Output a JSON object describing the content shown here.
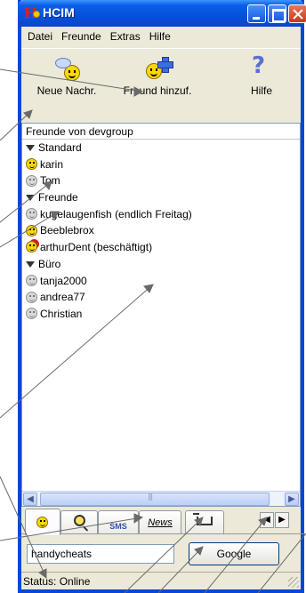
{
  "window": {
    "title": "HCIM",
    "logo_letter": "H"
  },
  "menu": [
    "Datei",
    "Freunde",
    "Extras",
    "Hilfe"
  ],
  "toolbar": {
    "news": "Neue Nachr.",
    "add_friend": "Freund hinzuf.",
    "help": "Hilfe"
  },
  "list": {
    "header": "Freunde von devgroup",
    "rows": [
      {
        "type": "group",
        "text": "Standard"
      },
      {
        "type": "online",
        "text": "karin"
      },
      {
        "type": "offline",
        "text": "Tom"
      },
      {
        "type": "group",
        "text": "Freunde"
      },
      {
        "type": "offline",
        "text": "kugelaugenfish (endlich Freitag)"
      },
      {
        "type": "online",
        "text": "Beeblebrox"
      },
      {
        "type": "busy",
        "text": "arthurDent (beschäftigt)"
      },
      {
        "type": "group",
        "text": "Büro"
      },
      {
        "type": "offline",
        "text": "tanja2000"
      },
      {
        "type": "offline",
        "text": "andrea77"
      },
      {
        "type": "offline",
        "text": "Christian"
      }
    ]
  },
  "tabs": {
    "sms": "SMS",
    "news": "News"
  },
  "search": {
    "value": "handycheats",
    "button": "Google"
  },
  "status": "Status: Online",
  "colors": {
    "titlebar": "#0550dd",
    "frame": "#0a46d8",
    "online": "#ffd800",
    "offline": "#d8d8d8",
    "callout": "#6a6a6a"
  }
}
